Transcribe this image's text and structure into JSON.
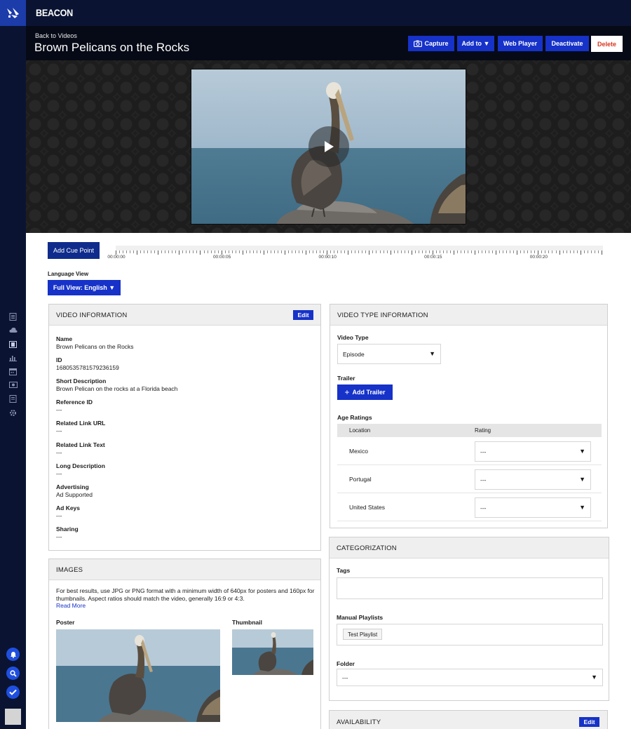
{
  "app": {
    "brand": "BEACON"
  },
  "header": {
    "back_label": "Back to Videos",
    "title": "Brown Pelicans on the Rocks",
    "buttons": {
      "capture": "Capture",
      "add_to": "Add to ▼",
      "web_player": "Web Player",
      "deactivate": "Deactivate",
      "delete": "Delete"
    }
  },
  "colors": {
    "navy": "#0a1432",
    "accent": "#1632c8",
    "danger": "#d9361f"
  },
  "cue": {
    "button": "Add Cue Point",
    "ticks": [
      "00:00:00",
      "00:00:05",
      "00:00:10",
      "00:00:15",
      "00:00:20"
    ]
  },
  "language": {
    "label": "Language View",
    "button": "Full View: English ▼"
  },
  "video_info": {
    "title": "VIDEO INFORMATION",
    "edit": "Edit",
    "fields": [
      {
        "label": "Name",
        "value": "Brown Pelicans on the Rocks"
      },
      {
        "label": "ID",
        "value": "1680535781579236159"
      },
      {
        "label": "Short Description",
        "value": "Brown Pelican on the rocks at a Florida beach"
      },
      {
        "label": "Reference ID",
        "value": "---"
      },
      {
        "label": "Related Link URL",
        "value": "---"
      },
      {
        "label": "Related Link Text",
        "value": "---"
      },
      {
        "label": "Long Description",
        "value": "---"
      },
      {
        "label": "Advertising",
        "value": "Ad Supported"
      },
      {
        "label": "Ad Keys",
        "value": "---"
      },
      {
        "label": "Sharing",
        "value": "---"
      }
    ]
  },
  "video_type": {
    "title": "VIDEO TYPE INFORMATION",
    "type_label": "Video Type",
    "type_value": "Episode",
    "trailer_label": "Trailer",
    "add_trailer": "Add Trailer",
    "age_label": "Age Ratings",
    "col_location": "Location",
    "col_rating": "Rating",
    "rows": [
      {
        "location": "Mexico",
        "rating": "---"
      },
      {
        "location": "Portugal",
        "rating": "---"
      },
      {
        "location": "United States",
        "rating": "---"
      }
    ]
  },
  "images": {
    "title": "IMAGES",
    "help": "For best results, use JPG or PNG format with a minimum width of 640px for posters and 160px for thumbnails. Aspect ratios should match the video, generally 16:9 or 4:3.",
    "read_more": "Read More",
    "poster_label": "Poster",
    "thumbnail_label": "Thumbnail"
  },
  "categorization": {
    "title": "CATEGORIZATION",
    "tags_label": "Tags",
    "playlists_label": "Manual Playlists",
    "playlist_chip": "Test Playlist",
    "folder_label": "Folder",
    "folder_value": "---"
  },
  "availability": {
    "title": "AVAILABILITY",
    "edit": "Edit"
  }
}
